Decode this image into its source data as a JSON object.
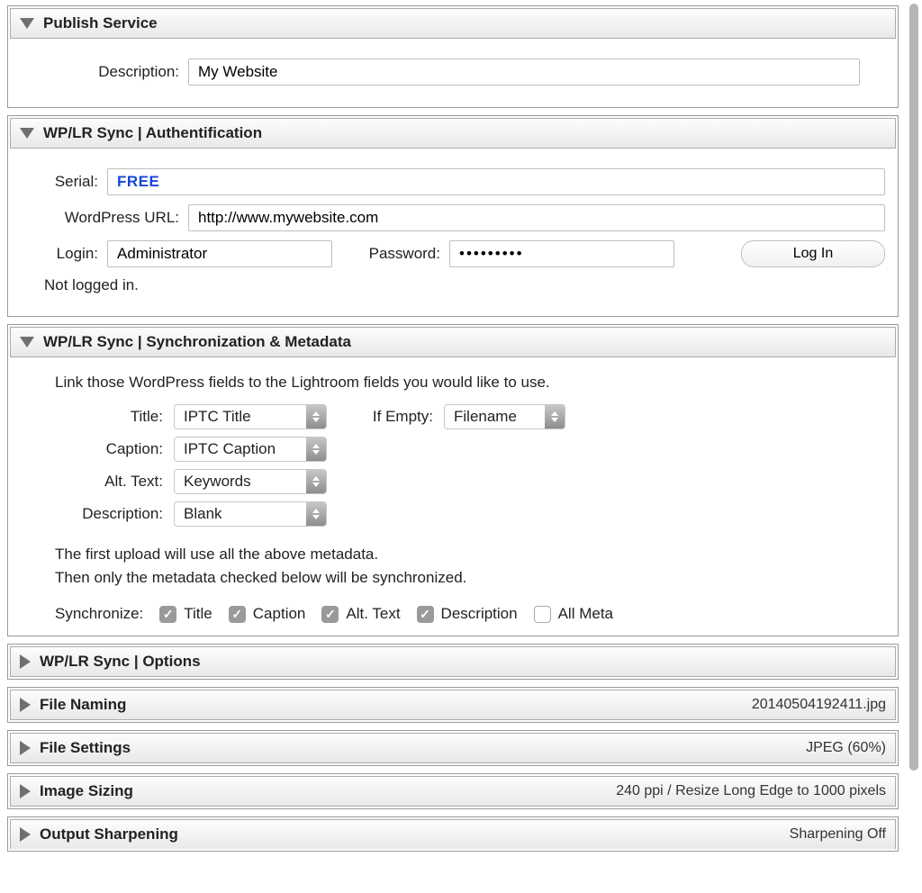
{
  "sections": {
    "publish": {
      "title": "Publish Service",
      "description_label": "Description:",
      "description_value": "My Website"
    },
    "auth": {
      "title": "WP/LR Sync | Authentification",
      "serial_label": "Serial:",
      "serial_value": "FREE",
      "wpurl_label": "WordPress URL:",
      "wpurl_value": "http://www.mywebsite.com",
      "login_label": "Login:",
      "login_value": "Administrator",
      "password_label": "Password:",
      "password_value": "•••••••••",
      "login_button": "Log In",
      "status": "Not logged in."
    },
    "sync": {
      "title": "WP/LR Sync | Synchronization & Metadata",
      "intro": "Link those WordPress fields to the Lightroom fields you would like to use.",
      "title_label": "Title:",
      "title_value": "IPTC Title",
      "ifempty_label": "If Empty:",
      "ifempty_value": "Filename",
      "caption_label": "Caption:",
      "caption_value": "IPTC Caption",
      "alt_label": "Alt. Text:",
      "alt_value": "Keywords",
      "desc_label": "Description:",
      "desc_value": "Blank",
      "note1": "The first upload will use all the above metadata.",
      "note2": "Then only the metadata checked below will be synchronized.",
      "sync_label": "Synchronize:",
      "chk_title": "Title",
      "chk_caption": "Caption",
      "chk_alt": "Alt. Text",
      "chk_desc": "Description",
      "chk_all": "All Meta"
    },
    "options": {
      "title": "WP/LR Sync | Options"
    },
    "filenaming": {
      "title": "File Naming",
      "summary": "20140504192411.jpg"
    },
    "filesettings": {
      "title": "File Settings",
      "summary": "JPEG (60%)"
    },
    "imagesizing": {
      "title": "Image Sizing",
      "summary": "240 ppi / Resize Long Edge to 1000 pixels"
    },
    "sharpening": {
      "title": "Output Sharpening",
      "summary": "Sharpening Off"
    }
  }
}
